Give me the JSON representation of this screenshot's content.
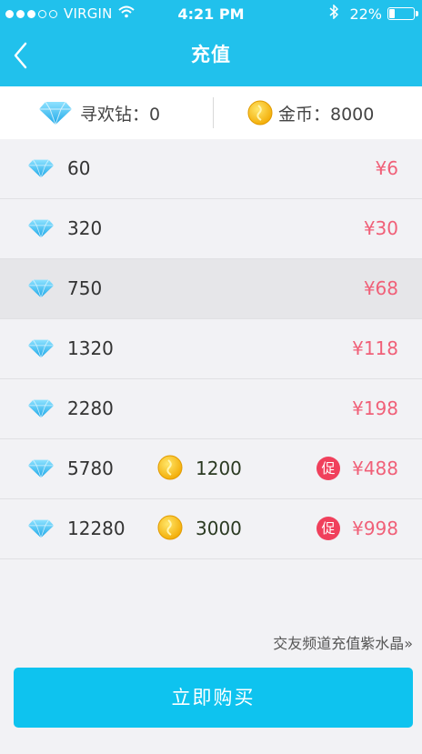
{
  "status": {
    "carrier": "VIRGIN",
    "time": "4:21 PM",
    "battery": "22%"
  },
  "nav": {
    "title": "充值"
  },
  "balance": {
    "diamond_label": "寻欢钻：0",
    "coin_label": "金币：8000"
  },
  "packages": [
    {
      "amount": "60",
      "price": "¥6"
    },
    {
      "amount": "320",
      "price": "¥30"
    },
    {
      "amount": "750",
      "price": "¥68"
    },
    {
      "amount": "1320",
      "price": "¥118"
    },
    {
      "amount": "2280",
      "price": "¥198"
    },
    {
      "amount": "5780",
      "bonus": "1200",
      "promo": "促",
      "price": "¥488"
    },
    {
      "amount": "12280",
      "bonus": "3000",
      "promo": "促",
      "price": "¥998"
    }
  ],
  "link": {
    "label": "交友频道充值紫水晶»"
  },
  "buy": {
    "label": "立即购买"
  },
  "colors": {
    "header": "#21c1ec",
    "button": "#0ec3ef",
    "price": "#f06078",
    "promo": "#f0405c"
  },
  "icons": [
    "back-chevron-icon",
    "diamond-icon",
    "coin-icon",
    "promo-badge-icon",
    "wifi-icon",
    "bluetooth-icon",
    "battery-icon"
  ]
}
